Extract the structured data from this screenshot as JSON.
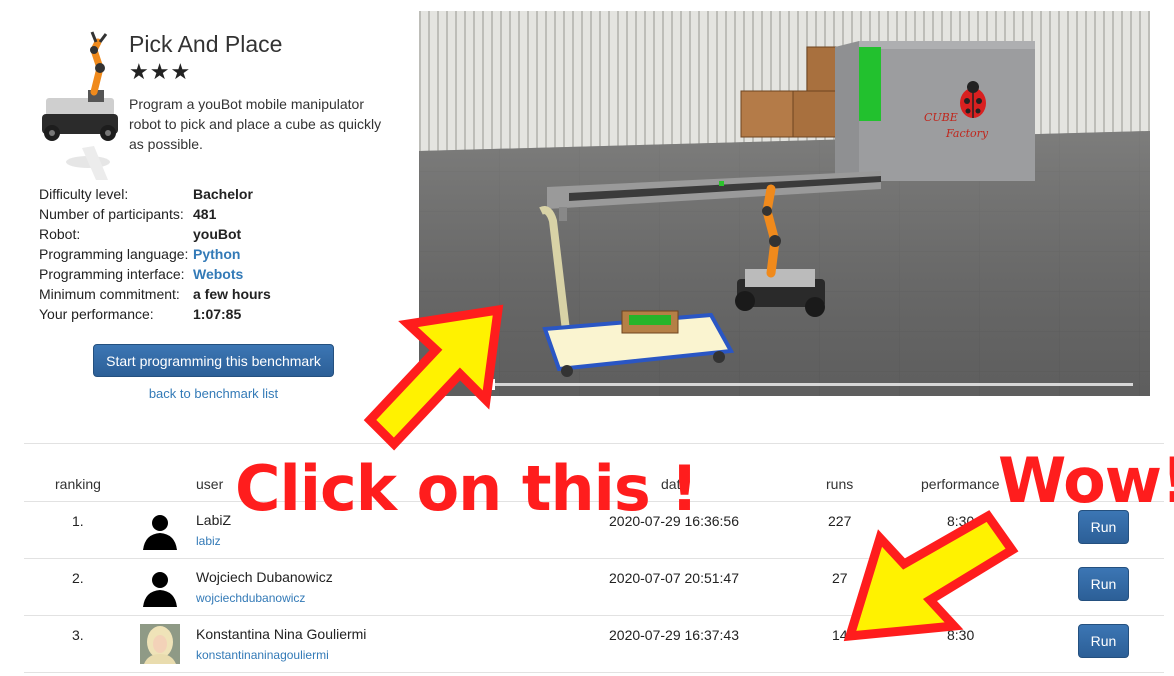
{
  "benchmark": {
    "title": "Pick And Place",
    "stars": "★★★",
    "description": "Program a youBot mobile manipulator robot to pick and place a cube as quickly as possible.",
    "details": [
      {
        "label": "Difficulty level:",
        "value": "Bachelor",
        "link": false
      },
      {
        "label": "Number of participants:",
        "value": "481",
        "link": false
      },
      {
        "label": "Robot:",
        "value": "youBot",
        "link": false
      },
      {
        "label": "Programming language:",
        "value": "Python",
        "link": true
      },
      {
        "label": "Programming interface:",
        "value": "Webots",
        "link": true
      },
      {
        "label": "Minimum commitment:",
        "value": "a few hours",
        "link": false
      },
      {
        "label": "Your performance:",
        "value": "1:07:85",
        "link": false
      }
    ],
    "start_button": "Start programming this benchmark",
    "back_link": "back to benchmark list"
  },
  "simulation": {
    "factory_label_1": "CUBE",
    "factory_label_2": "Factory",
    "progress_fraction": 0.0
  },
  "leaderboard": {
    "headers": {
      "ranking": "ranking",
      "user": "user",
      "date": "date",
      "runs": "runs",
      "performance": "performance"
    },
    "rows": [
      {
        "rank": "1.",
        "name": "LabiZ",
        "handle": "labiz",
        "date": "2020-07-29 16:36:56",
        "runs": "227",
        "performance": "8:30",
        "action": "Run"
      },
      {
        "rank": "2.",
        "name": "Wojciech Dubanowicz",
        "handle": "wojciechdubanowicz",
        "date": "2020-07-07 20:51:47",
        "runs": "27",
        "performance": "",
        "action": "Run"
      },
      {
        "rank": "3.",
        "name": "Konstantina Nina Gouliermi",
        "handle": "konstantinaninagouliermi",
        "date": "2020-07-29 16:37:43",
        "runs": "14",
        "performance": "8:30",
        "action": "Run"
      }
    ]
  },
  "annotations": {
    "click_text": "Click on this !",
    "wow_text": "Wow!",
    "red": "#ff1d1d",
    "yellow": "#fff200"
  },
  "colors": {
    "link": "#337ab7",
    "button": "#2f67a3"
  }
}
